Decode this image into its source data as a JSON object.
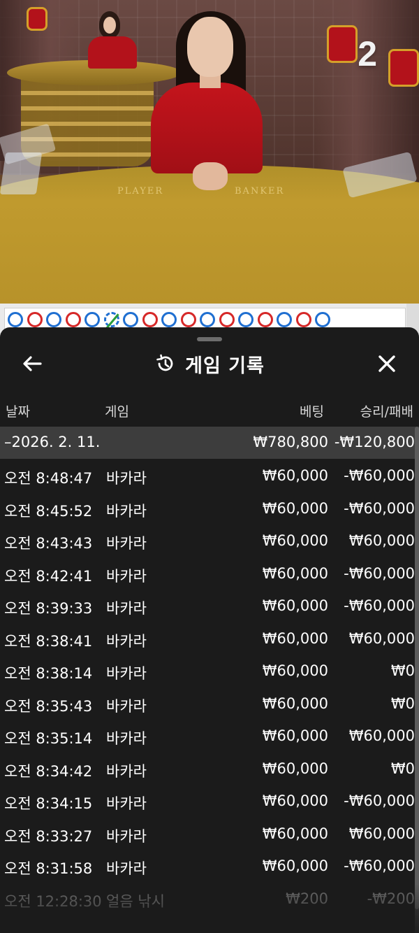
{
  "video": {
    "round_number": "2",
    "table_labels": {
      "player": "PLAYER",
      "banker": "BANKER"
    }
  },
  "roadmap": {
    "results": [
      "player",
      "banker",
      "player",
      "banker",
      "player",
      "tie",
      "player",
      "banker",
      "player",
      "banker",
      "player",
      "banker",
      "player",
      "banker",
      "player",
      "banker",
      "player"
    ]
  },
  "history": {
    "title": "게임 기록",
    "back_icon": "arrow-left-icon",
    "close_icon": "close-icon",
    "title_icon": "history-icon",
    "columns": {
      "date": "날짜",
      "game": "게임",
      "bet": "베팅",
      "result": "승리/패배"
    },
    "summary": {
      "date": "–2026. 2. 11.",
      "bet": "₩780,800",
      "result": "-₩120,800"
    },
    "rows": [
      {
        "time": "오전 8:48:47",
        "game": "바카라",
        "bet": "₩60,000",
        "result": "-₩60,000"
      },
      {
        "time": "오전 8:45:52",
        "game": "바카라",
        "bet": "₩60,000",
        "result": "-₩60,000"
      },
      {
        "time": "오전 8:43:43",
        "game": "바카라",
        "bet": "₩60,000",
        "result": "₩60,000"
      },
      {
        "time": "오전 8:42:41",
        "game": "바카라",
        "bet": "₩60,000",
        "result": "-₩60,000"
      },
      {
        "time": "오전 8:39:33",
        "game": "바카라",
        "bet": "₩60,000",
        "result": "-₩60,000"
      },
      {
        "time": "오전 8:38:41",
        "game": "바카라",
        "bet": "₩60,000",
        "result": "₩60,000"
      },
      {
        "time": "오전 8:38:14",
        "game": "바카라",
        "bet": "₩60,000",
        "result": "₩0"
      },
      {
        "time": "오전 8:35:43",
        "game": "바카라",
        "bet": "₩60,000",
        "result": "₩0"
      },
      {
        "time": "오전 8:35:14",
        "game": "바카라",
        "bet": "₩60,000",
        "result": "₩60,000"
      },
      {
        "time": "오전 8:34:42",
        "game": "바카라",
        "bet": "₩60,000",
        "result": "₩0"
      },
      {
        "time": "오전 8:34:15",
        "game": "바카라",
        "bet": "₩60,000",
        "result": "-₩60,000"
      },
      {
        "time": "오전 8:33:27",
        "game": "바카라",
        "bet": "₩60,000",
        "result": "₩60,000"
      },
      {
        "time": "오전 8:31:58",
        "game": "바카라",
        "bet": "₩60,000",
        "result": "-₩60,000"
      },
      {
        "time": "오전 12:28:30",
        "game": "얼음 낚시",
        "bet": "₩200",
        "result": "-₩200"
      }
    ]
  },
  "colors": {
    "sheet_bg": "#1b1b1b",
    "summary_bg": "#3d3d3d",
    "player": "#1f6fd1",
    "banker": "#d62828",
    "tie": "#2a9d3a"
  }
}
